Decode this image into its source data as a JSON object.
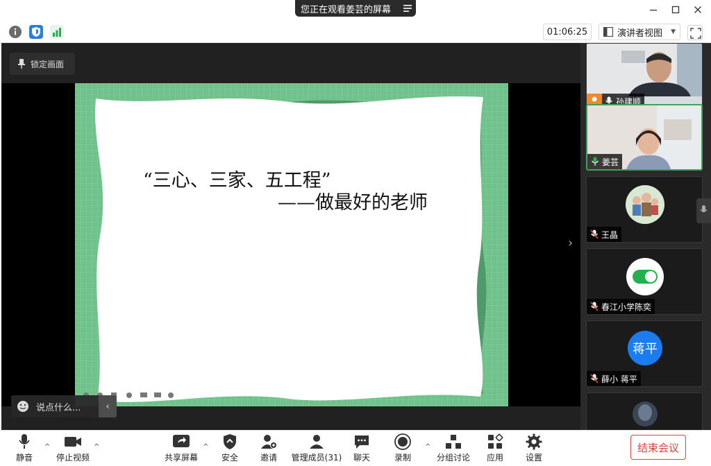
{
  "title_bar": {
    "share_notice": "您正在观看姜芸的屏幕",
    "menu_icon": "menu-icon",
    "minimize_icon": "minimize-icon",
    "maximize_icon": "maximize-icon",
    "close_icon": "close-icon"
  },
  "top_bar": {
    "info_icon": "info-icon",
    "shield_icon": "shield-icon",
    "signal_icon": "signal-icon",
    "elapsed": "01:06:25",
    "view_mode": "演讲者视图",
    "fullscreen_icon": "fullscreen-icon"
  },
  "stage": {
    "lock_label": "锁定画面",
    "slide": {
      "line1": "“三心、三家、五工程”",
      "line2": "——做最好的老师"
    },
    "comment_placeholder": "说点什么..."
  },
  "gallery": [
    {
      "name": "孙建顺",
      "muted": false,
      "host": true
    },
    {
      "name": "姜芸",
      "muted": false,
      "host": false
    },
    {
      "name": "王晶",
      "muted": true,
      "host": false
    },
    {
      "name": "春江小学陈奕",
      "muted": true,
      "host": false
    },
    {
      "name": "薛小 蒋平",
      "muted": true,
      "host": false,
      "avatar_text": "蒋平"
    },
    {
      "name": "",
      "muted": true,
      "host": false
    }
  ],
  "bottom_bar": {
    "mute": "静音",
    "stop_video": "停止视频",
    "share_screen": "共享屏幕",
    "security": "安全",
    "invite": "邀请",
    "participants": "管理成员(31)",
    "chat": "聊天",
    "record": "录制",
    "breakout": "分组讨论",
    "apps": "应用",
    "settings": "设置",
    "end_meeting": "结束会议"
  },
  "colors": {
    "stage_bg": "#212121",
    "slide_green": "#6fc28a",
    "end_red": "#e0443a",
    "avatar_blue": "#1a7cf0",
    "toggle_green": "#22b14c"
  }
}
